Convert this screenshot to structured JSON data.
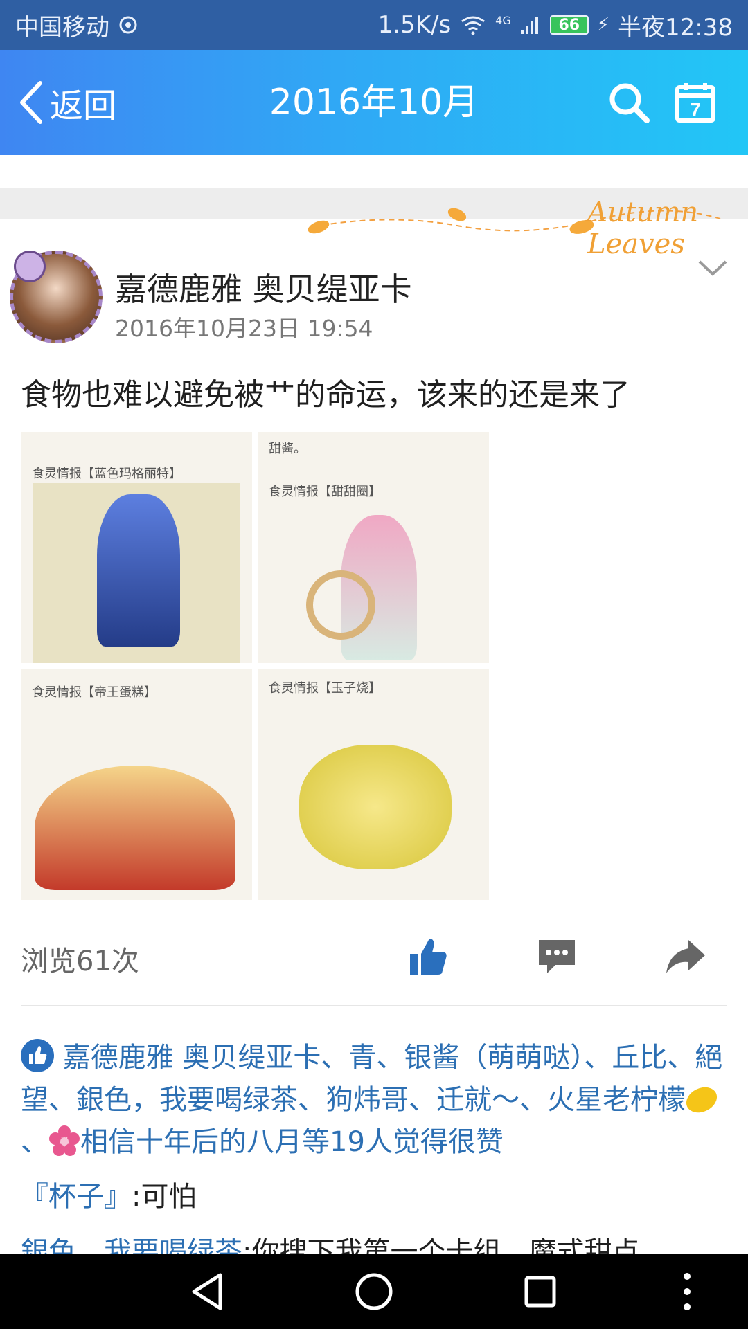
{
  "status_bar": {
    "carrier": "中国移动",
    "speed": "1.5K/s",
    "network": "4G",
    "battery": "66",
    "time": "半夜12:38"
  },
  "nav": {
    "back_label": "返回",
    "title": "2016年10月"
  },
  "decoration": {
    "text": "Autumn Leaves"
  },
  "post": {
    "author": "嘉德鹿雅 奥贝缇亚卡",
    "timestamp": "2016年10月23日 19:54",
    "text": "食物也难以避免被艹的命运，该来的还是来了",
    "images": [
      {
        "top_note": "",
        "caption": "食灵情报【蓝色玛格丽特】"
      },
      {
        "top_note": "甜酱。",
        "caption": "食灵情报【甜甜圈】"
      },
      {
        "top_note": "",
        "caption": "食灵情报【帝王蛋糕】"
      },
      {
        "top_note": "",
        "caption": "食灵情报【玉子烧】"
      }
    ],
    "views": "浏览61次"
  },
  "likes": {
    "part1": "嘉德鹿雅 奥贝缇亚卡、青、银酱（萌萌哒）、丘比、絕望、銀色，我要喝绿茶、狗炜哥、迁就～、火星老柠檬",
    "part2": "、",
    "part3": "相信十年后的八月等19人觉得很赞"
  },
  "comments": [
    {
      "user": "『杯子』",
      "sep": ":",
      "text": "可怕"
    },
    {
      "user": "銀色，我要喝绿茶",
      "sep": ":",
      "text": "你搜下我第一个卡组，魔式甜点。"
    }
  ],
  "colors": {
    "status_bar": "#2f5fa3",
    "nav_gradient_start": "#3f86f2",
    "nav_gradient_end": "#22c6f6",
    "link_blue": "#2c6fb3",
    "icon_blue": "#2a6fbd"
  }
}
